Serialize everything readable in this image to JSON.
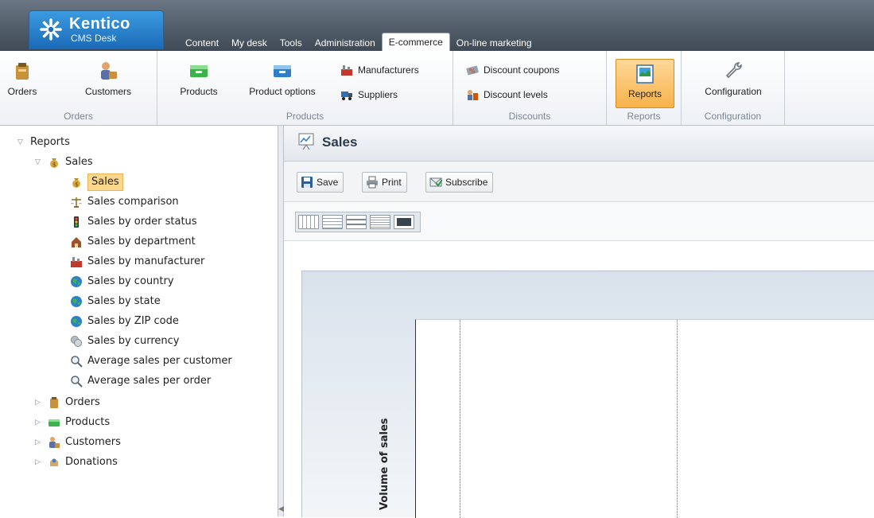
{
  "app": {
    "brand": "Kentico",
    "product": "CMS Desk"
  },
  "tabs": [
    {
      "label": "Content"
    },
    {
      "label": "My desk"
    },
    {
      "label": "Tools"
    },
    {
      "label": "Administration"
    },
    {
      "label": "E-commerce",
      "active": true
    },
    {
      "label": "On-line marketing"
    }
  ],
  "ribbon": {
    "orders_group": {
      "title": "Orders",
      "orders": "Orders",
      "customers": "Customers"
    },
    "products_group": {
      "title": "Products",
      "products": "Products",
      "product_options": "Product options",
      "manufacturers": "Manufacturers",
      "suppliers": "Suppliers"
    },
    "discounts_group": {
      "title": "Discounts",
      "coupons": "Discount coupons",
      "levels": "Discount levels"
    },
    "reports_group": {
      "title": "Reports",
      "reports": "Reports"
    },
    "config_group": {
      "title": "Configuration",
      "configuration": "Configuration"
    }
  },
  "tree": {
    "root": "Reports",
    "sales": "Sales",
    "sales_items": [
      {
        "label": "Sales",
        "icon": "money-bag-icon",
        "selected": true
      },
      {
        "label": "Sales comparison",
        "icon": "scales-icon"
      },
      {
        "label": "Sales by order status",
        "icon": "traffic-light-icon"
      },
      {
        "label": "Sales by department",
        "icon": "department-icon"
      },
      {
        "label": "Sales by manufacturer",
        "icon": "manufacturer-icon"
      },
      {
        "label": "Sales by country",
        "icon": "globe-icon"
      },
      {
        "label": "Sales by state",
        "icon": "globe-icon"
      },
      {
        "label": "Sales by ZIP code",
        "icon": "globe-icon"
      },
      {
        "label": "Sales by currency",
        "icon": "coins-icon"
      },
      {
        "label": "Average sales per customer",
        "icon": "magnifier-icon"
      },
      {
        "label": "Average sales per order",
        "icon": "magnifier-icon"
      }
    ],
    "other": [
      {
        "label": "Orders",
        "icon": "orders-icon"
      },
      {
        "label": "Products",
        "icon": "products-icon"
      },
      {
        "label": "Customers",
        "icon": "customers-icon"
      },
      {
        "label": "Donations",
        "icon": "donations-icon"
      }
    ]
  },
  "content": {
    "title": "Sales",
    "save": "Save",
    "print": "Print",
    "subscribe": "Subscribe",
    "chart_ylabel": "Volume of sales"
  },
  "colors": {
    "accent": "#1b6bb8",
    "selected_bg": "#fbd78b",
    "ribbon_active": "#f7b24a"
  }
}
